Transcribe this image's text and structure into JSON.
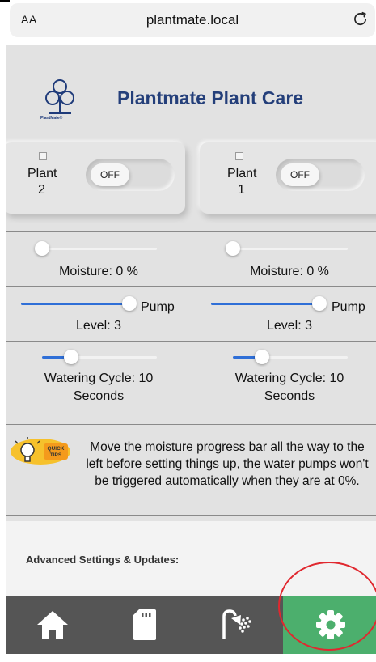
{
  "browser": {
    "text_size_label": "AA",
    "url": "plantmate.local"
  },
  "header": {
    "logo_label": "PlantMate®",
    "title": "Plantmate Plant Care"
  },
  "plants": [
    {
      "label": "Plant",
      "number": "2",
      "toggle": "OFF"
    },
    {
      "label": "Plant",
      "number": "1",
      "toggle": "OFF"
    }
  ],
  "moisture": [
    {
      "label": "Moisture: 0 %",
      "value_percent": 0
    },
    {
      "label": "Moisture: 0 %",
      "value_percent": 0
    }
  ],
  "pump": [
    {
      "label_top": "Pump",
      "label_bottom": "Level: 3",
      "fraction": 1.0
    },
    {
      "label_top": "Pump",
      "label_bottom": "Level: 3",
      "fraction": 1.0
    }
  ],
  "watering": [
    {
      "line1": "Watering Cycle: 10",
      "line2": "Seconds",
      "fraction": 0.25
    },
    {
      "line1": "Watering Cycle: 10",
      "line2": "Seconds",
      "fraction": 0.25
    }
  ],
  "tips": {
    "badge": "QUICK TIPS",
    "text": "Move the moisture progress bar all the way to the left before setting things up, the water pumps won't be triggered automatically when they are at 0%."
  },
  "advanced": {
    "title": "Advanced Settings & Updates:"
  },
  "nav": {
    "items": [
      "home-icon",
      "sd-card-icon",
      "shower-icon",
      "gear-icon"
    ],
    "active": "gear-icon",
    "active_color": "#4caf6d"
  },
  "colors": {
    "title": "#243f7a",
    "accent": "#2f6fd7",
    "nav_bg": "#555555",
    "highlight_ring": "#e0282f"
  }
}
